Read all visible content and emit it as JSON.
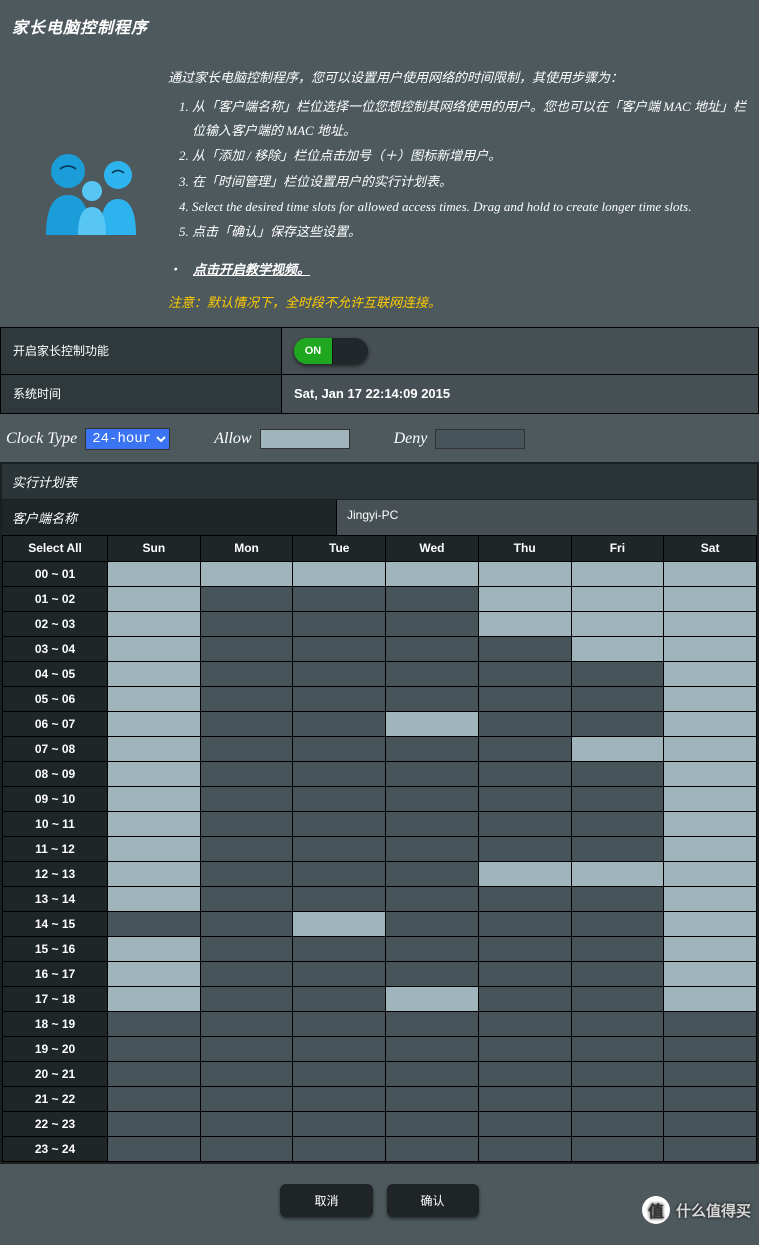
{
  "title": "家长电脑控制程序",
  "intro": {
    "lead": "通过家长电脑控制程序，您可以设置用户使用网络的时间限制，其使用步骤为：",
    "steps": [
      "从「客户端名称」栏位选择一位您想控制其网络使用的用户。您也可以在「客户端 MAC 地址」栏位输入客户端的 MAC 地址。",
      "从「添加 / 移除」栏位点击加号（＋）图标新增用户。",
      "在「时间管理」栏位设置用户的实行计划表。",
      "Select the desired time slots for allowed access times. Drag and hold to create longer time slots.",
      "点击「确认」保存这些设置。"
    ],
    "video": "点击开启教学视频。",
    "warn": "注意：默认情况下，全时段不允许互联网连接。"
  },
  "settings": {
    "enable_label": "开启家长控制功能",
    "toggle_on": "ON",
    "systime_label": "系统时间",
    "systime_value": "Sat, Jan 17 22:14:09 2015"
  },
  "clock": {
    "type_label": "Clock Type",
    "type_value": "24-hour",
    "allow_label": "Allow",
    "deny_label": "Deny"
  },
  "schedule": {
    "title": "实行计划表",
    "client_label": "客户端名称",
    "client_value": "Jingyi-PC",
    "select_all": "Select All",
    "days": [
      "Sun",
      "Mon",
      "Tue",
      "Wed",
      "Thu",
      "Fri",
      "Sat"
    ],
    "hours": [
      "00 ~ 01",
      "01 ~ 02",
      "02 ~ 03",
      "03 ~ 04",
      "04 ~ 05",
      "05 ~ 06",
      "06 ~ 07",
      "07 ~ 08",
      "08 ~ 09",
      "09 ~ 10",
      "10 ~ 11",
      "11 ~ 12",
      "12 ~ 13",
      "13 ~ 14",
      "14 ~ 15",
      "15 ~ 16",
      "16 ~ 17",
      "17 ~ 18",
      "18 ~ 19",
      "19 ~ 20",
      "20 ~ 21",
      "21 ~ 22",
      "22 ~ 23",
      "23 ~ 24"
    ],
    "allow_cells": [
      [
        0,
        0
      ],
      [
        0,
        1
      ],
      [
        0,
        2
      ],
      [
        0,
        3
      ],
      [
        0,
        4
      ],
      [
        0,
        5
      ],
      [
        0,
        6
      ],
      [
        1,
        0
      ],
      [
        1,
        4
      ],
      [
        1,
        5
      ],
      [
        1,
        6
      ],
      [
        2,
        0
      ],
      [
        2,
        4
      ],
      [
        2,
        5
      ],
      [
        2,
        6
      ],
      [
        3,
        0
      ],
      [
        3,
        5
      ],
      [
        3,
        6
      ],
      [
        4,
        0
      ],
      [
        4,
        6
      ],
      [
        5,
        0
      ],
      [
        5,
        6
      ],
      [
        6,
        0
      ],
      [
        6,
        3
      ],
      [
        6,
        6
      ],
      [
        7,
        0
      ],
      [
        7,
        5
      ],
      [
        7,
        6
      ],
      [
        8,
        0
      ],
      [
        8,
        6
      ],
      [
        9,
        0
      ],
      [
        9,
        6
      ],
      [
        10,
        0
      ],
      [
        10,
        6
      ],
      [
        11,
        0
      ],
      [
        11,
        6
      ],
      [
        12,
        0
      ],
      [
        12,
        4
      ],
      [
        12,
        5
      ],
      [
        12,
        6
      ],
      [
        13,
        0
      ],
      [
        13,
        6
      ],
      [
        14,
        2
      ],
      [
        14,
        6
      ],
      [
        15,
        0
      ],
      [
        15,
        6
      ],
      [
        16,
        0
      ],
      [
        16,
        6
      ],
      [
        17,
        0
      ],
      [
        17,
        3
      ],
      [
        17,
        6
      ]
    ]
  },
  "buttons": {
    "cancel": "取消",
    "ok": "确认"
  },
  "watermark": {
    "badge": "值",
    "text": "什么值得买"
  }
}
